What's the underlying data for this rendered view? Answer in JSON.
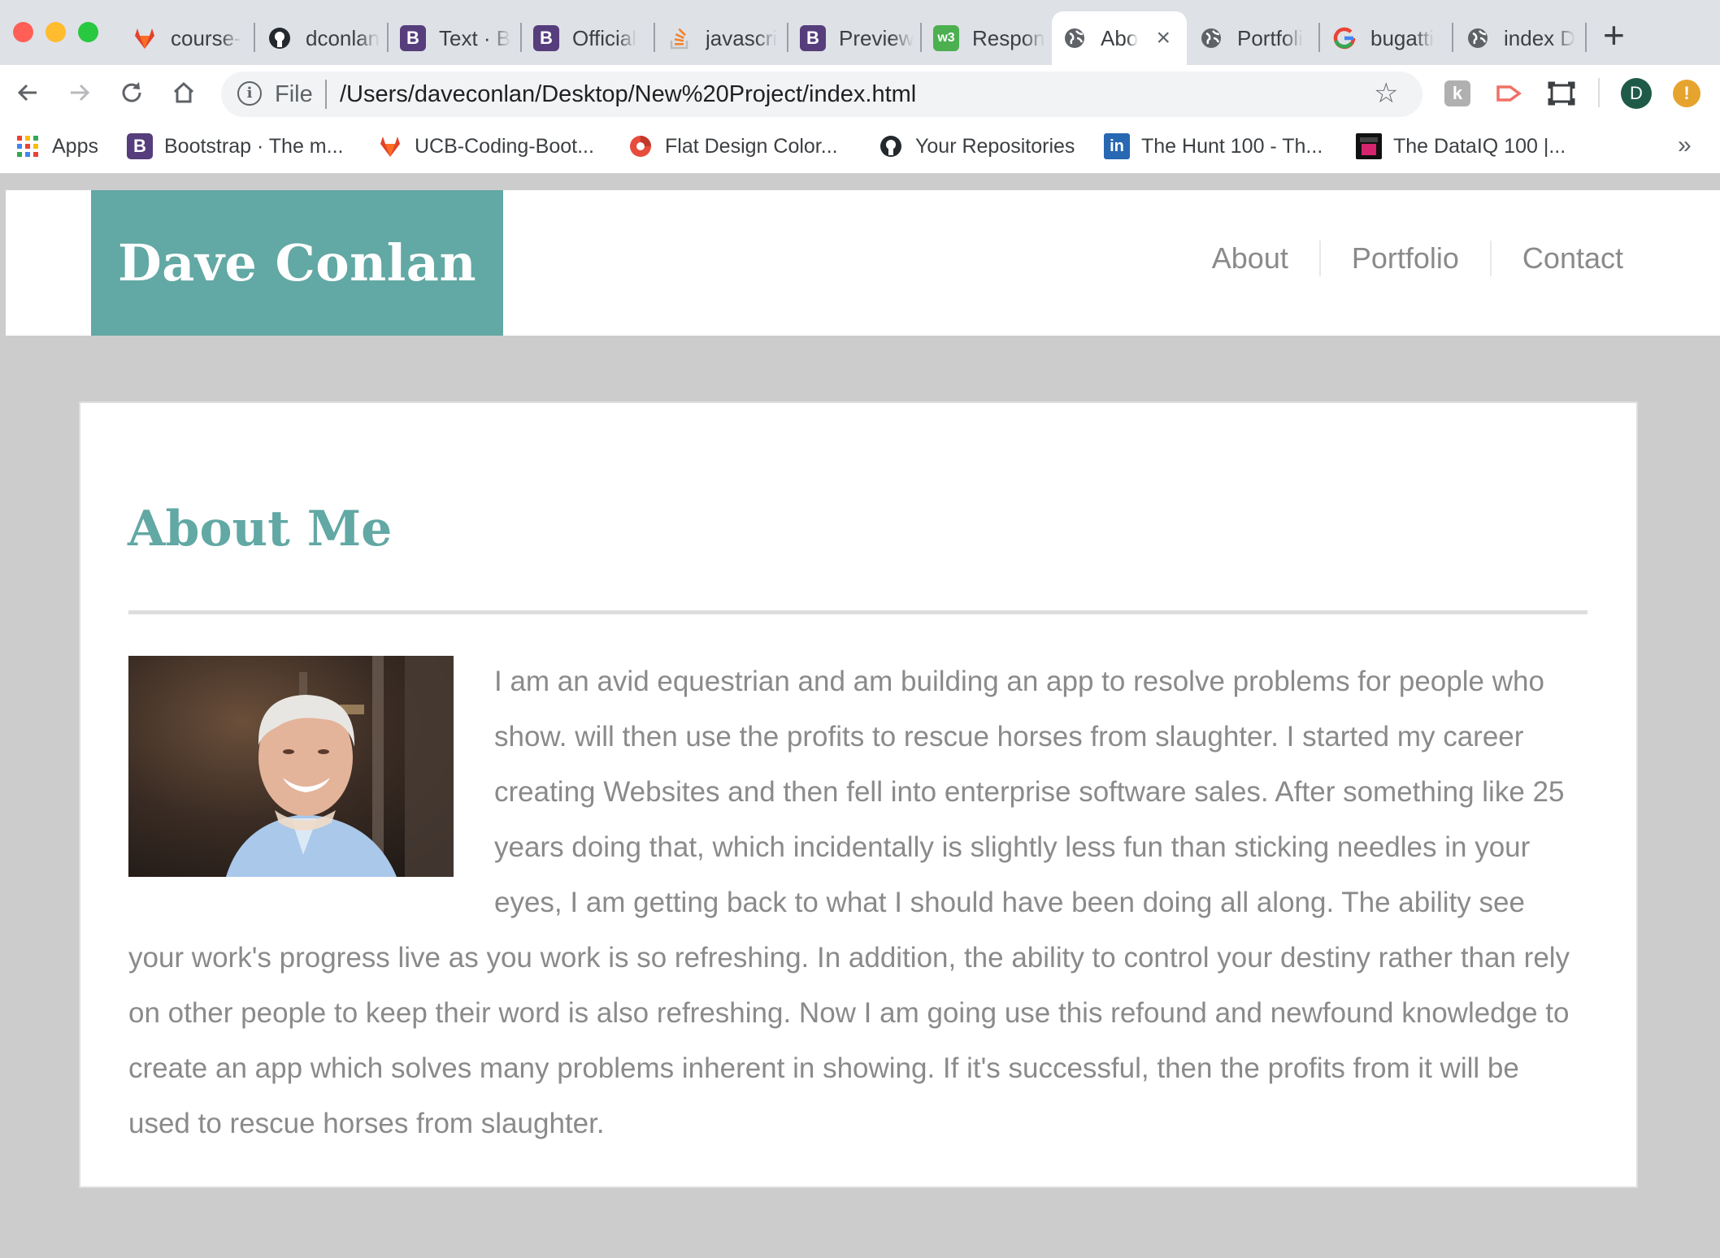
{
  "browser": {
    "tabs": [
      {
        "title": "course-",
        "icon": "gitlab-icon",
        "color": "#e24329"
      },
      {
        "title": "dconlan",
        "icon": "github-icon",
        "color": "#24292e"
      },
      {
        "title": "Text · B",
        "icon": "bootstrap-icon",
        "color": "#563d7c"
      },
      {
        "title": "Official",
        "icon": "bootstrap-icon",
        "color": "#563d7c"
      },
      {
        "title": "javascri",
        "icon": "stackoverflow-icon",
        "color": "#f48024"
      },
      {
        "title": "Preview",
        "icon": "bootstrap-icon",
        "color": "#563d7c"
      },
      {
        "title": "Respon",
        "icon": "w3schools-icon",
        "color": "#4caf50"
      },
      {
        "title": "Abo",
        "icon": "globe-icon",
        "color": "#3c4043",
        "active": true
      },
      {
        "title": "Portfoli",
        "icon": "globe-icon",
        "color": "#3c4043"
      },
      {
        "title": "bugatti",
        "icon": "google-icon",
        "color": "#4285f4"
      },
      {
        "title": "index D",
        "icon": "globe-icon",
        "color": "#3c4043"
      }
    ],
    "address": {
      "scheme": "File",
      "url": "/Users/daveconlan/Desktop/New%20Project/index.html"
    },
    "profile_initial": "D",
    "alert_glyph": "!",
    "bookmarks": [
      {
        "label": "Apps",
        "icon": "apps-grid-icon"
      },
      {
        "label": "Bootstrap · The m...",
        "icon": "bootstrap-icon",
        "color": "#563d7c"
      },
      {
        "label": "UCB-Coding-Boot...",
        "icon": "gitlab-icon",
        "color": "#e24329"
      },
      {
        "label": "Flat Design Color...",
        "icon": "flat-design-icon",
        "color": "#e74c3c"
      },
      {
        "label": "Your Repositories",
        "icon": "github-icon",
        "color": "#24292e"
      },
      {
        "label": "The Hunt 100 - Th...",
        "icon": "linkedin-icon",
        "color": "#2867b2"
      },
      {
        "label": "The DataIQ 100 |...",
        "icon": "dataiq-icon",
        "color": "#d6246e"
      }
    ],
    "more_glyph": "»"
  },
  "site": {
    "brand": "Dave Conlan",
    "nav": [
      "About",
      "Portfolio",
      "Contact"
    ],
    "accent_color": "#62a8a4"
  },
  "about": {
    "heading": "About Me",
    "body": "I am an avid equestrian and am building an app to resolve problems for people who show. will then use the profits to rescue horses from slaughter. I started my career creating Websites and then fell into enterprise software sales. After something like 25 years doing that, which incidentally is slightly less fun than sticking needles in your eyes, I am getting back to what I should have been doing all along. The ability see your work's progress live as you work is so refreshing. In addition, the ability to control your destiny rather than rely on other people to keep their word is also refreshing. Now I am going use this refound and newfound knowledge to create an app which solves many problems inherent in showing. If it's successful, then the profits from it will be used to rescue horses from slaughter."
  }
}
